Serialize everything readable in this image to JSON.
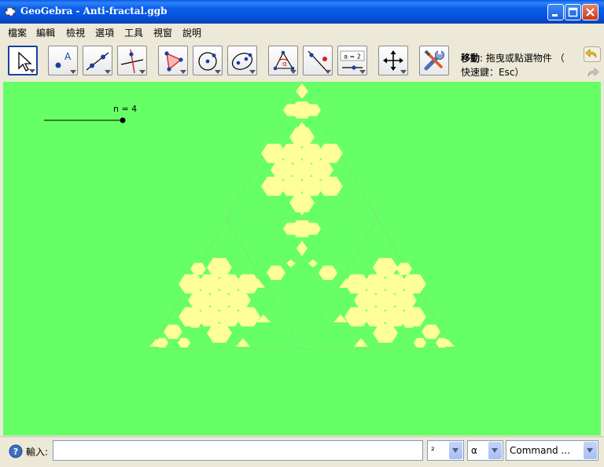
{
  "window": {
    "title": "GeoGebra - Anti-fractal.ggb",
    "colors": {
      "titlebar": "#0553dd",
      "canvas": "#66ff66",
      "fractal": "#ffff99"
    }
  },
  "menu": {
    "items": [
      {
        "label": "檔案"
      },
      {
        "label": "編輯"
      },
      {
        "label": "檢視"
      },
      {
        "label": "選項"
      },
      {
        "label": "工具"
      },
      {
        "label": "視窗"
      },
      {
        "label": "說明"
      }
    ]
  },
  "toolbar": {
    "tools": [
      {
        "name": "move-tool",
        "icon": "cursor-arrow-icon",
        "active": true
      },
      {
        "name": "point-tool",
        "icon": "point-icon"
      },
      {
        "name": "line-tool",
        "icon": "line-through-two-points-icon"
      },
      {
        "name": "perpendicular-tool",
        "icon": "perpendicular-line-icon"
      },
      {
        "name": "polygon-tool",
        "icon": "polygon-icon"
      },
      {
        "name": "circle-tool",
        "icon": "circle-icon"
      },
      {
        "name": "conic-tool",
        "icon": "ellipse-icon"
      },
      {
        "name": "angle-tool",
        "icon": "angle-icon"
      },
      {
        "name": "reflect-tool",
        "icon": "reflect-icon"
      },
      {
        "name": "slider-tool",
        "icon": "slider-icon"
      },
      {
        "name": "move-view-tool",
        "icon": "move-graphics-icon"
      },
      {
        "name": "settings-tool",
        "icon": "tools-wrench-icon"
      }
    ],
    "slider_icon_text": "a = 2",
    "help_title": "移動",
    "help_text": ": 拖曳或點選物件 （",
    "help_shortcut": "快速鍵：Esc）"
  },
  "canvas": {
    "slider_label": "n = 4",
    "slider_value": 4
  },
  "input_bar": {
    "label": "輸入:",
    "value": "",
    "exponent_combo": "²",
    "greek_combo": "α",
    "command_combo": "Command ..."
  }
}
